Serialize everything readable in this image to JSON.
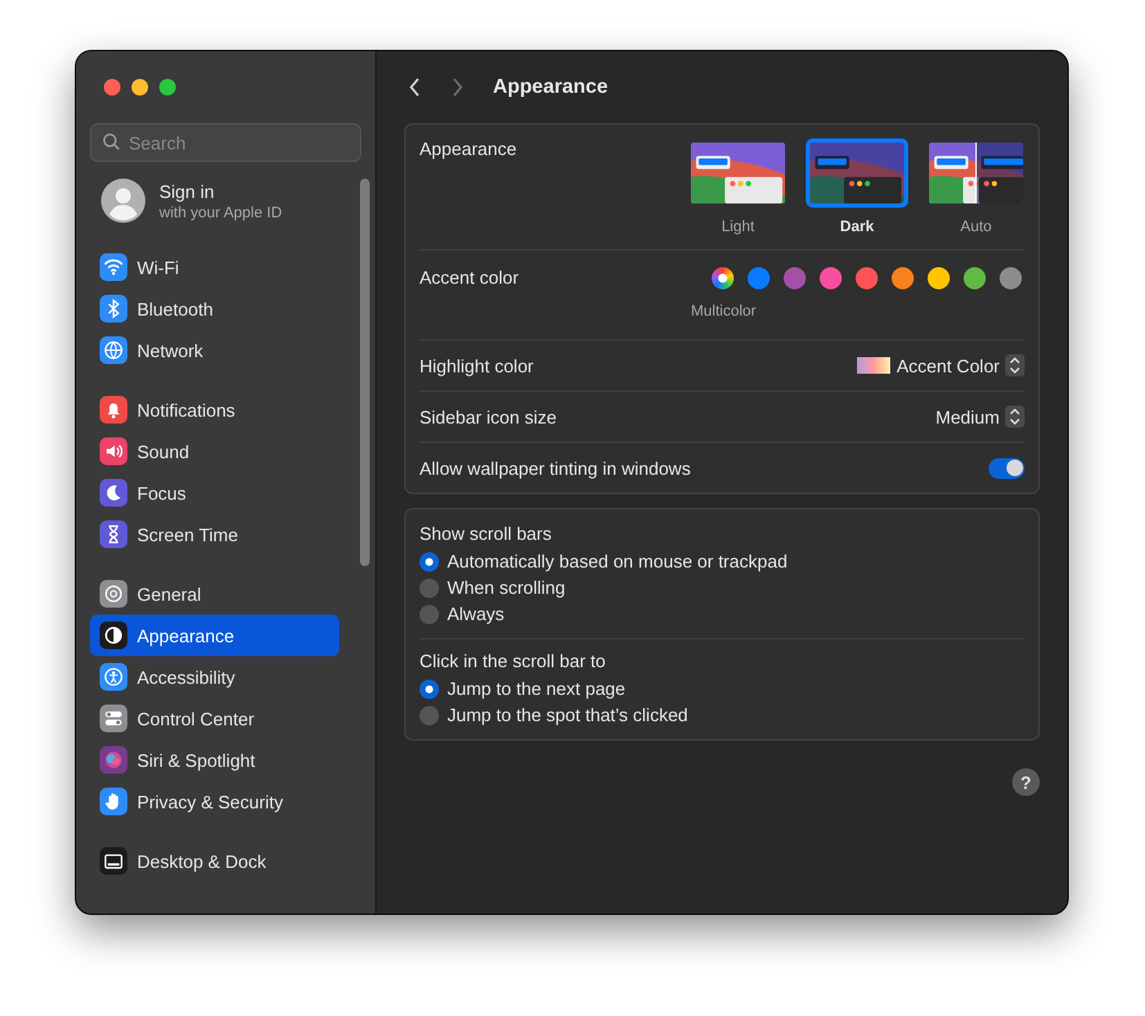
{
  "window": {
    "title": "Appearance"
  },
  "search": {
    "placeholder": "Search"
  },
  "account": {
    "title": "Sign in",
    "subtitle": "with your Apple ID"
  },
  "sidebar": {
    "groups": [
      {
        "items": [
          {
            "label": "Wi-Fi",
            "color": "#2f8cf5",
            "selected": false
          },
          {
            "label": "Bluetooth",
            "color": "#2f8cf5",
            "selected": false
          },
          {
            "label": "Network",
            "color": "#2f8cf5",
            "selected": false
          }
        ]
      },
      {
        "items": [
          {
            "label": "Notifications",
            "color": "#ee4b47",
            "selected": false
          },
          {
            "label": "Sound",
            "color": "#eb4468",
            "selected": false
          },
          {
            "label": "Focus",
            "color": "#6259d6",
            "selected": false
          },
          {
            "label": "Screen Time",
            "color": "#6259d6",
            "selected": false
          }
        ]
      },
      {
        "items": [
          {
            "label": "General",
            "color": "#8e8e93",
            "selected": false
          },
          {
            "label": "Appearance",
            "color": "#1c1c1e",
            "selected": true
          },
          {
            "label": "Accessibility",
            "color": "#2f8cf5",
            "selected": false
          },
          {
            "label": "Control Center",
            "color": "#8e8e93",
            "selected": false
          },
          {
            "label": "Siri & Spotlight",
            "color": "#7a3b8c",
            "selected": false
          },
          {
            "label": "Privacy & Security",
            "color": "#2f8cf5",
            "selected": false
          }
        ]
      },
      {
        "items": [
          {
            "label": "Desktop & Dock",
            "color": "#1c1c1e",
            "selected": false
          }
        ]
      }
    ]
  },
  "appearance": {
    "label": "Appearance",
    "options": [
      {
        "label": "Light",
        "kind": "light",
        "selected": false
      },
      {
        "label": "Dark",
        "kind": "dark",
        "selected": true
      },
      {
        "label": "Auto",
        "kind": "auto",
        "selected": false
      }
    ]
  },
  "accent": {
    "label": "Accent color",
    "caption": "Multicolor",
    "colors": [
      {
        "kind": "multicolor",
        "selected": true
      },
      {
        "kind": "solid",
        "color": "#0a7aff",
        "selected": false
      },
      {
        "kind": "solid",
        "color": "#a550a7",
        "selected": false
      },
      {
        "kind": "solid",
        "color": "#f74f9e",
        "selected": false
      },
      {
        "kind": "solid",
        "color": "#ff5257",
        "selected": false
      },
      {
        "kind": "solid",
        "color": "#f7821b",
        "selected": false
      },
      {
        "kind": "solid",
        "color": "#ffc600",
        "selected": false
      },
      {
        "kind": "solid",
        "color": "#62ba46",
        "selected": false
      },
      {
        "kind": "solid",
        "color": "#8c8c8c",
        "selected": false
      }
    ]
  },
  "highlight": {
    "label": "Highlight color",
    "value": "Accent Color"
  },
  "icon_size": {
    "label": "Sidebar icon size",
    "value": "Medium"
  },
  "tinting": {
    "label": "Allow wallpaper tinting in windows",
    "on": true
  },
  "scroll_bars": {
    "label": "Show scroll bars",
    "options": [
      {
        "label": "Automatically based on mouse or trackpad",
        "selected": true
      },
      {
        "label": "When scrolling",
        "selected": false
      },
      {
        "label": "Always",
        "selected": false
      }
    ]
  },
  "click_scroll": {
    "label": "Click in the scroll bar to",
    "options": [
      {
        "label": "Jump to the next page",
        "selected": true
      },
      {
        "label": "Jump to the spot that’s clicked",
        "selected": false
      }
    ]
  },
  "help": {
    "label": "?"
  }
}
